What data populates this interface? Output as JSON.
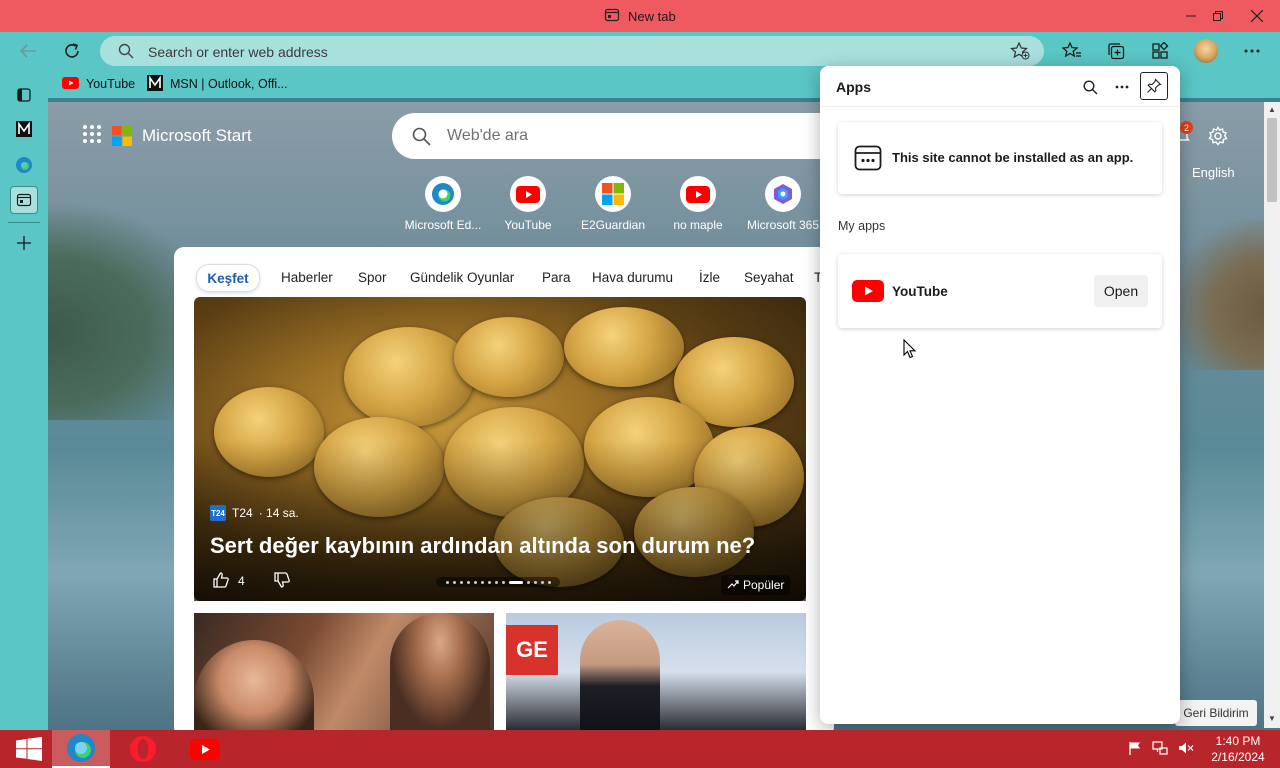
{
  "window": {
    "tab_title": "New tab"
  },
  "address_bar": {
    "placeholder": "Search or enter web address"
  },
  "favorites": [
    {
      "label": "YouTube",
      "icon": "youtube-icon"
    },
    {
      "label": "MSN | Outlook, Offi...",
      "icon": "msn-icon"
    }
  ],
  "ms_start": {
    "brand": "Microsoft Start",
    "search_placeholder": "Web'de ara",
    "quick_links": [
      {
        "label": "Microsoft Ed...",
        "icon": "edge-icon"
      },
      {
        "label": "YouTube",
        "icon": "youtube-icon"
      },
      {
        "label": "E2Guardian",
        "icon": "windows-logo-icon"
      },
      {
        "label": "no maple",
        "icon": "youtube-icon"
      },
      {
        "label": "Microsoft 365",
        "icon": "m365-icon"
      }
    ],
    "tabs": [
      "Keşfet",
      "Haberler",
      "Spor",
      "Gündelik Oyunlar",
      "Para",
      "Hava durumu",
      "İzle",
      "Seyahat",
      "T"
    ],
    "hero": {
      "source": "T24",
      "time": "· 14 sa.",
      "title": "Sert değer kaybının ardından altında son durum ne?",
      "likes": "4",
      "badge": "Popüler"
    },
    "notification_count": "2",
    "language": "English",
    "feedback": "Geri Bildirim"
  },
  "apps_panel": {
    "title": "Apps",
    "notice": "This site cannot be installed as an app.",
    "my_apps_label": "My apps",
    "apps": [
      {
        "name": "YouTube",
        "action": "Open"
      }
    ]
  },
  "taskbar": {
    "time": "1:40 PM",
    "date": "2/16/2024"
  },
  "colors": {
    "titlebar": "#ef5a60",
    "toolbar": "#5ac6c5",
    "taskbar": "#b8262b",
    "youtube_red": "#ff0000"
  }
}
